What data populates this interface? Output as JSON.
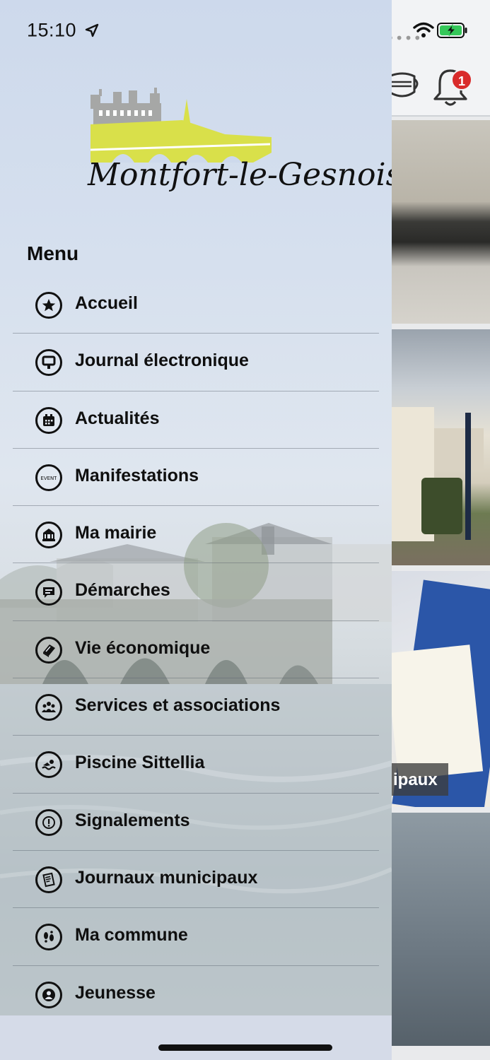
{
  "status_bar": {
    "time": "15:10"
  },
  "brand": {
    "logo_text": "Montfort-le-Gesnois"
  },
  "menu": {
    "title": "Menu",
    "items": [
      {
        "label": "Accueil",
        "icon": "star-icon"
      },
      {
        "label": "Journal électronique",
        "icon": "billboard-icon"
      },
      {
        "label": "Actualités",
        "icon": "calendar-icon"
      },
      {
        "label": "Manifestations",
        "icon": "event-icon"
      },
      {
        "label": "Ma mairie",
        "icon": "town-hall-icon"
      },
      {
        "label": "Démarches",
        "icon": "chat-bubble-icon"
      },
      {
        "label": "Vie économique",
        "icon": "book-icon"
      },
      {
        "label": "Services et associations",
        "icon": "group-icon"
      },
      {
        "label": "Piscine Sittellia",
        "icon": "swimmer-icon"
      },
      {
        "label": "Signalements",
        "icon": "warning-icon"
      },
      {
        "label": "Journaux municipaux",
        "icon": "newspaper-icon"
      },
      {
        "label": "Ma commune",
        "icon": "footprints-icon"
      },
      {
        "label": "Jeunesse",
        "icon": "user-icon"
      }
    ]
  },
  "background_app": {
    "notification_count": "1",
    "tile_caption": "ipaux"
  },
  "colors": {
    "badge": "#d92b2b",
    "logo_yellow": "#d9e04a",
    "battery_green": "#35c759"
  }
}
